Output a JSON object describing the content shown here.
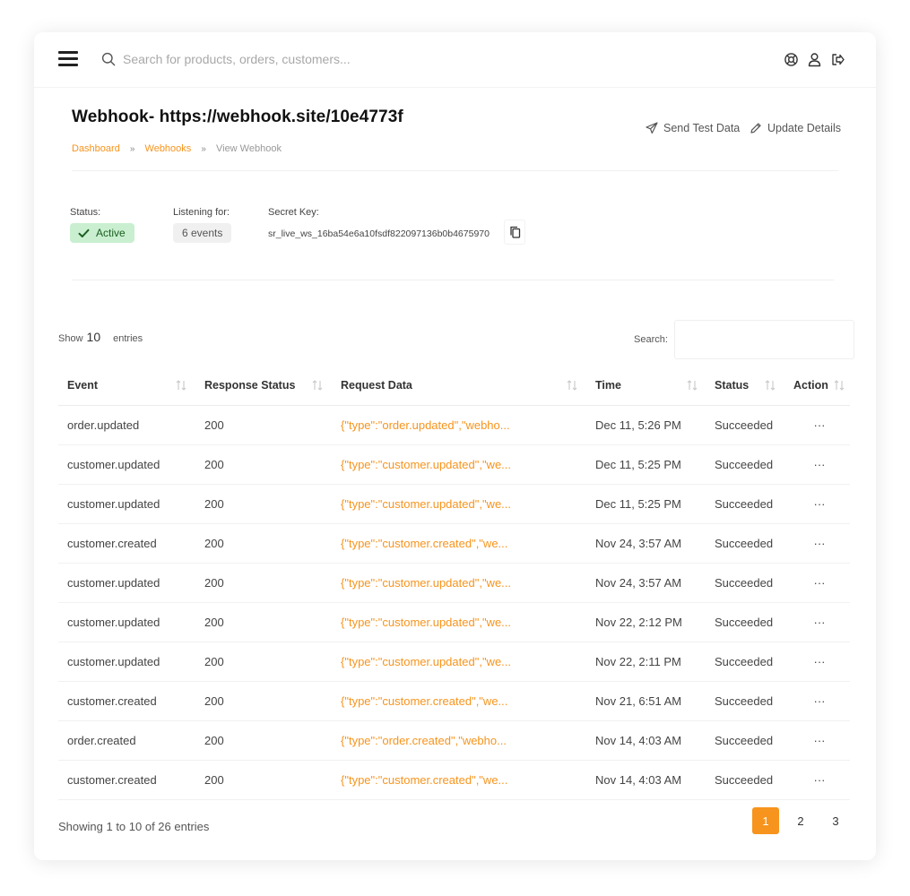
{
  "colors": {
    "accent": "#f7941d",
    "success_bg": "#c9efd0",
    "success_text": "#1b5e20"
  },
  "topbar": {
    "search_placeholder": "Search for products, orders, customers..."
  },
  "header": {
    "title": "Webhook- https://webhook.site/10e4773f",
    "breadcrumb": {
      "dashboard": "Dashboard",
      "sep": "»",
      "webhooks": "Webhooks",
      "current": "View Webhook"
    },
    "send_test_label": "Send Test Data",
    "update_details_label": "Update Details"
  },
  "details": {
    "status_label": "Status:",
    "status_value": "Active",
    "listening_label": "Listening for:",
    "listening_value": "6 events",
    "secret_label": "Secret Key:",
    "secret_value": "sr_live_ws_16ba54e6a10fsdf822097136b0b4675970"
  },
  "table_controls": {
    "show_label": "Show",
    "show_value": "10",
    "entries_label": "entries",
    "search_label": "Search:"
  },
  "table": {
    "headers": {
      "event": "Event",
      "response": "Response Status",
      "request": "Request Data",
      "time": "Time",
      "status": "Status",
      "action": "Action"
    },
    "rows": [
      {
        "event": "order.updated",
        "response": "200",
        "request": "{\"type\":\"order.updated\",\"webho...",
        "time": "Dec 11, 5:26 PM",
        "status": "Succeeded",
        "action": "···"
      },
      {
        "event": "customer.updated",
        "response": "200",
        "request": "{\"type\":\"customer.updated\",\"we...",
        "time": "Dec 11, 5:25 PM",
        "status": "Succeeded",
        "action": "···"
      },
      {
        "event": "customer.updated",
        "response": "200",
        "request": "{\"type\":\"customer.updated\",\"we...",
        "time": "Dec 11, 5:25 PM",
        "status": "Succeeded",
        "action": "···"
      },
      {
        "event": "customer.created",
        "response": "200",
        "request": "{\"type\":\"customer.created\",\"we...",
        "time": "Nov 24, 3:57 AM",
        "status": "Succeeded",
        "action": "···"
      },
      {
        "event": "customer.updated",
        "response": "200",
        "request": "{\"type\":\"customer.updated\",\"we...",
        "time": "Nov 24, 3:57 AM",
        "status": "Succeeded",
        "action": "···"
      },
      {
        "event": "customer.updated",
        "response": "200",
        "request": "{\"type\":\"customer.updated\",\"we...",
        "time": "Nov 22, 2:12 PM",
        "status": "Succeeded",
        "action": "···"
      },
      {
        "event": "customer.updated",
        "response": "200",
        "request": "{\"type\":\"customer.updated\",\"we...",
        "time": "Nov 22, 2:11 PM",
        "status": "Succeeded",
        "action": "···"
      },
      {
        "event": "customer.created",
        "response": "200",
        "request": "{\"type\":\"customer.created\",\"we...",
        "time": "Nov 21, 6:51 AM",
        "status": "Succeeded",
        "action": "···"
      },
      {
        "event": "order.created",
        "response": "200",
        "request": "{\"type\":\"order.created\",\"webho...",
        "time": "Nov 14, 4:03 AM",
        "status": "Succeeded",
        "action": "···"
      },
      {
        "event": "customer.created",
        "response": "200",
        "request": "{\"type\":\"customer.created\",\"we...",
        "time": "Nov 14, 4:03 AM",
        "status": "Succeeded",
        "action": "···"
      }
    ]
  },
  "footer": {
    "showing_text": "Showing 1 to 10 of 26 entries",
    "pages": [
      "1",
      "2",
      "3"
    ]
  }
}
